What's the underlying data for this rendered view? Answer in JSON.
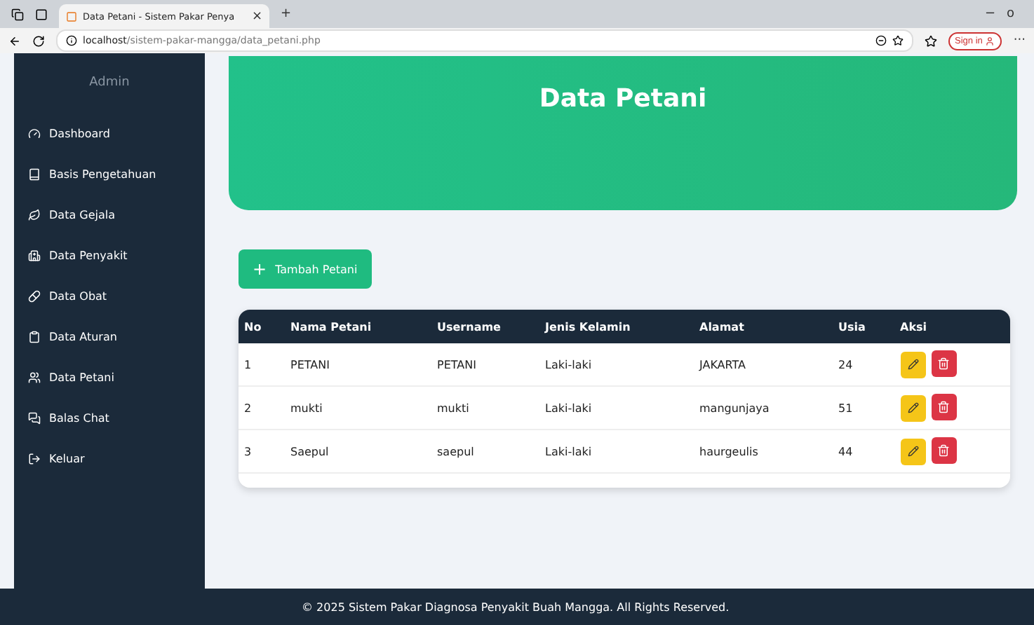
{
  "browser": {
    "tab_title": "Data Petani - Sistem Pakar Penya",
    "tab_close": "×",
    "new_tab": "+",
    "minimize": "−",
    "restore": "o",
    "url_host": "localhost",
    "url_path": "/sistem-pakar-mangga/data_petani.php",
    "sign_in": "Sign in",
    "more": "···"
  },
  "sidebar": {
    "title": "Admin",
    "items": [
      {
        "label": "Dashboard",
        "selected": false
      },
      {
        "label": "Basis Pengetahuan",
        "selected": false
      },
      {
        "label": "Data Gejala",
        "selected": false
      },
      {
        "label": "Data Penyakit",
        "selected": false
      },
      {
        "label": "Data Obat",
        "selected": false
      },
      {
        "label": "Data Aturan",
        "selected": false
      },
      {
        "label": "Data Petani",
        "selected": false
      },
      {
        "label": "Balas Chat",
        "selected": false
      },
      {
        "label": "Keluar",
        "selected": false
      }
    ]
  },
  "header": {
    "title": "Data Petani"
  },
  "add_button": {
    "icon": "+",
    "label": "Tambah Petani"
  },
  "table": {
    "columns": [
      "No",
      "Nama Petani",
      "Username",
      "Jenis Kelamin",
      "Alamat",
      "Usia",
      "Aksi"
    ],
    "rows": [
      [
        "1",
        "PETANI",
        "PETANI",
        "Laki-laki",
        "JAKARTA",
        "24"
      ],
      [
        "2",
        "mukti",
        "mukti",
        "Laki-laki",
        "mangunjaya",
        "51"
      ],
      [
        "3",
        "Saepul",
        "saepul",
        "Laki-laki",
        "haurgeulis",
        "44"
      ]
    ]
  },
  "footer": "© 2025 Sistem Pakar Diagnosa Penyakit Buah Mangga. All Rights Reserved."
}
